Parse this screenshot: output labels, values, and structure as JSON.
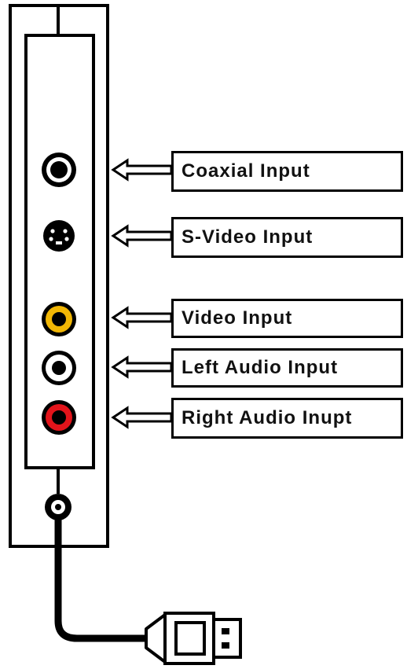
{
  "colors": {
    "line": "#000000",
    "coaxial": "#ffffff",
    "svideo": "#000000",
    "video": "#f2b705",
    "left_audio": "#ffffff",
    "right_audio": "#e3141b"
  },
  "labels": [
    {
      "text": "Coaxial Input"
    },
    {
      "text": "S-Video Input"
    },
    {
      "text": "Video Input"
    },
    {
      "text": "Left Audio Input"
    },
    {
      "text": "Right Audio Inupt"
    }
  ]
}
